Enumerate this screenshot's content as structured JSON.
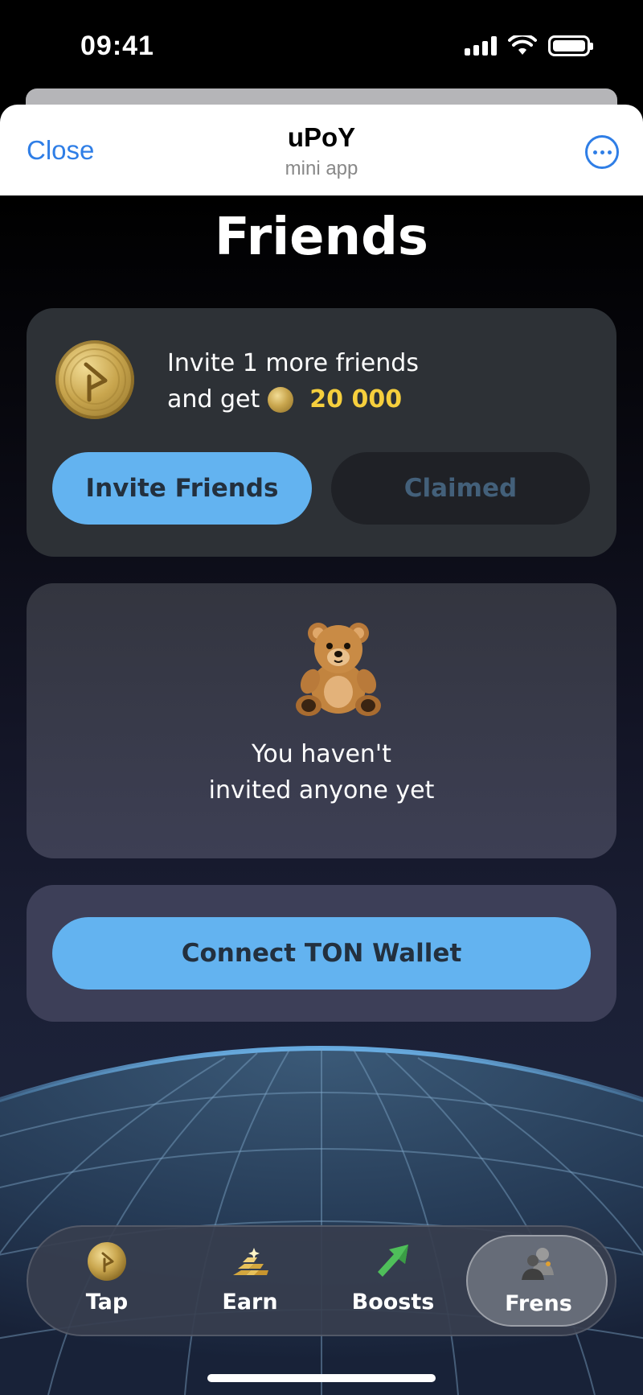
{
  "status_bar": {
    "time": "09:41"
  },
  "header": {
    "close_label": "Close",
    "title": "uPoY",
    "subtitle": "mini app"
  },
  "page": {
    "title": "Friends"
  },
  "invite_card": {
    "line1": "Invite 1 more friends",
    "line2_prefix": "and get",
    "reward": "20 000",
    "invite_button": "Invite Friends",
    "claimed_button": "Claimed"
  },
  "empty_state": {
    "line1": "You haven't",
    "line2": "invited anyone yet"
  },
  "wallet": {
    "button": "Connect TON Wallet"
  },
  "nav": {
    "items": [
      {
        "label": "Tap",
        "icon": "coin-icon"
      },
      {
        "label": "Earn",
        "icon": "gold-bars-icon"
      },
      {
        "label": "Boosts",
        "icon": "arrow-up-icon"
      },
      {
        "label": "Frens",
        "icon": "friends-icon"
      }
    ],
    "active": "Frens"
  },
  "colors": {
    "accent_blue": "#63b3f0",
    "link_blue": "#2f7ee6",
    "reward_gold": "#f6cf3d"
  }
}
